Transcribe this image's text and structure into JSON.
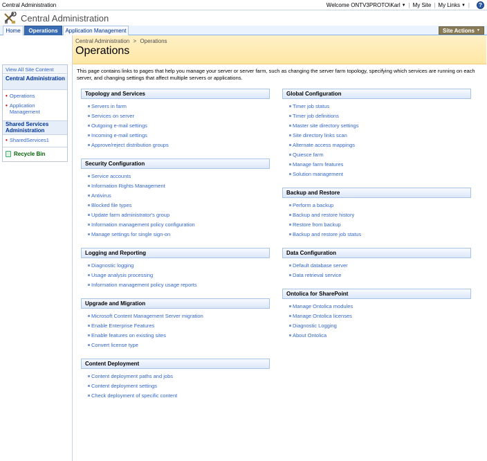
{
  "topbar": {
    "site_name": "Central Administration",
    "welcome": "Welcome ONTV3PROTO\\Karl",
    "my_site": "My Site",
    "my_links": "My Links",
    "help": "?"
  },
  "header": {
    "title": "Central Administration"
  },
  "tabs": [
    {
      "label": "Home",
      "active": false
    },
    {
      "label": "Operations",
      "active": true
    },
    {
      "label": "Application Management",
      "active": false
    }
  ],
  "site_actions": "Site Actions",
  "sidebar": {
    "view_all": "View All Site Content",
    "groups": [
      {
        "title": "Central Administration",
        "items": [
          "Operations",
          "Application Management"
        ]
      },
      {
        "title": "Shared Services Administration",
        "items": [
          "SharedServices1"
        ]
      }
    ],
    "recycle_bin": "Recycle Bin"
  },
  "page": {
    "breadcrumb_root": "Central Administration",
    "breadcrumb_sep": ">",
    "breadcrumb_current": "Operations",
    "title": "Operations",
    "intro": "This page contains links to pages that help you manage your server or server farm, such as changing the server farm topology, specifying which services are running on each server, and changing settings that affect multiple servers or applications."
  },
  "sections": {
    "topology": {
      "title": "Topology and Services",
      "links": [
        "Servers in farm",
        "Services on server",
        "Outgoing e-mail settings",
        "Incoming e-mail settings",
        "Approve/reject distribution groups"
      ]
    },
    "security": {
      "title": "Security Configuration",
      "links": [
        "Service accounts",
        "Information Rights Management",
        "Antivirus",
        "Blocked file types",
        "Update farm administrator's group",
        "Information management policy configuration",
        "Manage settings for single sign-on"
      ]
    },
    "logging": {
      "title": "Logging and Reporting",
      "links": [
        "Diagnostic logging",
        "Usage analysis processing",
        "Information management policy usage reports"
      ]
    },
    "upgrade": {
      "title": "Upgrade and Migration",
      "links": [
        "Microsoft Content Management Server migration",
        "Enable Enterprise Features",
        "Enable features on existing sites",
        "Convert license type"
      ]
    },
    "deployment": {
      "title": "Content Deployment",
      "links": [
        "Content deployment paths and jobs",
        "Content deployment settings",
        "Check deployment of specific content"
      ]
    },
    "global": {
      "title": "Global Configuration",
      "links": [
        "Timer job status",
        "Timer job definitions",
        "Master site directory settings",
        "Site directory links scan",
        "Alternate access mappings",
        "Quiesce farm",
        "Manage farm features",
        "Solution management"
      ]
    },
    "backup": {
      "title": "Backup and Restore",
      "links": [
        "Perform a backup",
        "Backup and restore history",
        "Restore from backup",
        "Backup and restore job status"
      ]
    },
    "data": {
      "title": "Data Configuration",
      "links": [
        "Default database server",
        "Data retrieval service"
      ]
    },
    "ontolica": {
      "title": "Ontolica for SharePoint",
      "links": [
        "Manage Ontolica modules",
        "Manage Ontolica licenses",
        "Diagnostic Logging",
        "About Ontolica"
      ]
    }
  }
}
